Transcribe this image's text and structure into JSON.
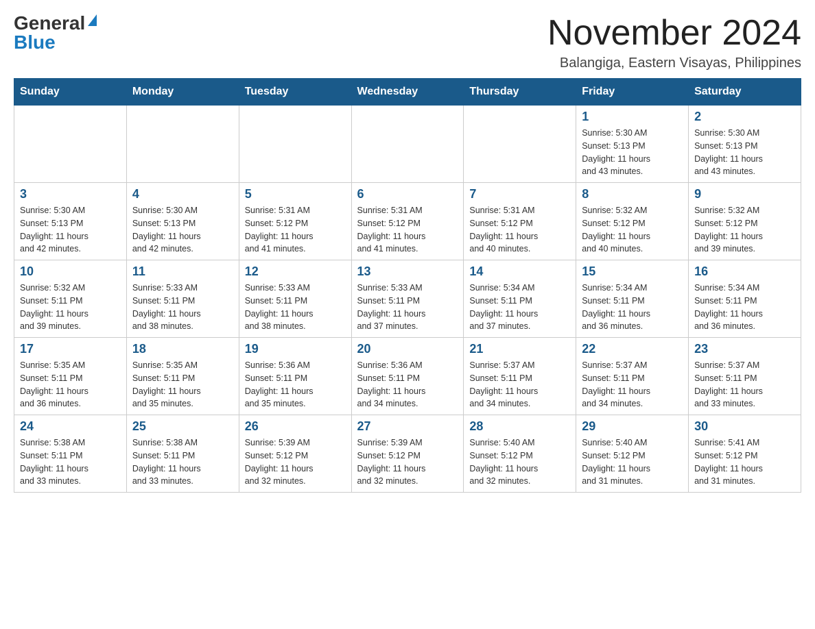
{
  "logo": {
    "general": "General",
    "blue": "Blue"
  },
  "title": "November 2024",
  "location": "Balangiga, Eastern Visayas, Philippines",
  "days_of_week": [
    "Sunday",
    "Monday",
    "Tuesday",
    "Wednesday",
    "Thursday",
    "Friday",
    "Saturday"
  ],
  "weeks": [
    [
      {
        "day": "",
        "info": ""
      },
      {
        "day": "",
        "info": ""
      },
      {
        "day": "",
        "info": ""
      },
      {
        "day": "",
        "info": ""
      },
      {
        "day": "",
        "info": ""
      },
      {
        "day": "1",
        "info": "Sunrise: 5:30 AM\nSunset: 5:13 PM\nDaylight: 11 hours\nand 43 minutes."
      },
      {
        "day": "2",
        "info": "Sunrise: 5:30 AM\nSunset: 5:13 PM\nDaylight: 11 hours\nand 43 minutes."
      }
    ],
    [
      {
        "day": "3",
        "info": "Sunrise: 5:30 AM\nSunset: 5:13 PM\nDaylight: 11 hours\nand 42 minutes."
      },
      {
        "day": "4",
        "info": "Sunrise: 5:30 AM\nSunset: 5:13 PM\nDaylight: 11 hours\nand 42 minutes."
      },
      {
        "day": "5",
        "info": "Sunrise: 5:31 AM\nSunset: 5:12 PM\nDaylight: 11 hours\nand 41 minutes."
      },
      {
        "day": "6",
        "info": "Sunrise: 5:31 AM\nSunset: 5:12 PM\nDaylight: 11 hours\nand 41 minutes."
      },
      {
        "day": "7",
        "info": "Sunrise: 5:31 AM\nSunset: 5:12 PM\nDaylight: 11 hours\nand 40 minutes."
      },
      {
        "day": "8",
        "info": "Sunrise: 5:32 AM\nSunset: 5:12 PM\nDaylight: 11 hours\nand 40 minutes."
      },
      {
        "day": "9",
        "info": "Sunrise: 5:32 AM\nSunset: 5:12 PM\nDaylight: 11 hours\nand 39 minutes."
      }
    ],
    [
      {
        "day": "10",
        "info": "Sunrise: 5:32 AM\nSunset: 5:11 PM\nDaylight: 11 hours\nand 39 minutes."
      },
      {
        "day": "11",
        "info": "Sunrise: 5:33 AM\nSunset: 5:11 PM\nDaylight: 11 hours\nand 38 minutes."
      },
      {
        "day": "12",
        "info": "Sunrise: 5:33 AM\nSunset: 5:11 PM\nDaylight: 11 hours\nand 38 minutes."
      },
      {
        "day": "13",
        "info": "Sunrise: 5:33 AM\nSunset: 5:11 PM\nDaylight: 11 hours\nand 37 minutes."
      },
      {
        "day": "14",
        "info": "Sunrise: 5:34 AM\nSunset: 5:11 PM\nDaylight: 11 hours\nand 37 minutes."
      },
      {
        "day": "15",
        "info": "Sunrise: 5:34 AM\nSunset: 5:11 PM\nDaylight: 11 hours\nand 36 minutes."
      },
      {
        "day": "16",
        "info": "Sunrise: 5:34 AM\nSunset: 5:11 PM\nDaylight: 11 hours\nand 36 minutes."
      }
    ],
    [
      {
        "day": "17",
        "info": "Sunrise: 5:35 AM\nSunset: 5:11 PM\nDaylight: 11 hours\nand 36 minutes."
      },
      {
        "day": "18",
        "info": "Sunrise: 5:35 AM\nSunset: 5:11 PM\nDaylight: 11 hours\nand 35 minutes."
      },
      {
        "day": "19",
        "info": "Sunrise: 5:36 AM\nSunset: 5:11 PM\nDaylight: 11 hours\nand 35 minutes."
      },
      {
        "day": "20",
        "info": "Sunrise: 5:36 AM\nSunset: 5:11 PM\nDaylight: 11 hours\nand 34 minutes."
      },
      {
        "day": "21",
        "info": "Sunrise: 5:37 AM\nSunset: 5:11 PM\nDaylight: 11 hours\nand 34 minutes."
      },
      {
        "day": "22",
        "info": "Sunrise: 5:37 AM\nSunset: 5:11 PM\nDaylight: 11 hours\nand 34 minutes."
      },
      {
        "day": "23",
        "info": "Sunrise: 5:37 AM\nSunset: 5:11 PM\nDaylight: 11 hours\nand 33 minutes."
      }
    ],
    [
      {
        "day": "24",
        "info": "Sunrise: 5:38 AM\nSunset: 5:11 PM\nDaylight: 11 hours\nand 33 minutes."
      },
      {
        "day": "25",
        "info": "Sunrise: 5:38 AM\nSunset: 5:11 PM\nDaylight: 11 hours\nand 33 minutes."
      },
      {
        "day": "26",
        "info": "Sunrise: 5:39 AM\nSunset: 5:12 PM\nDaylight: 11 hours\nand 32 minutes."
      },
      {
        "day": "27",
        "info": "Sunrise: 5:39 AM\nSunset: 5:12 PM\nDaylight: 11 hours\nand 32 minutes."
      },
      {
        "day": "28",
        "info": "Sunrise: 5:40 AM\nSunset: 5:12 PM\nDaylight: 11 hours\nand 32 minutes."
      },
      {
        "day": "29",
        "info": "Sunrise: 5:40 AM\nSunset: 5:12 PM\nDaylight: 11 hours\nand 31 minutes."
      },
      {
        "day": "30",
        "info": "Sunrise: 5:41 AM\nSunset: 5:12 PM\nDaylight: 11 hours\nand 31 minutes."
      }
    ]
  ]
}
